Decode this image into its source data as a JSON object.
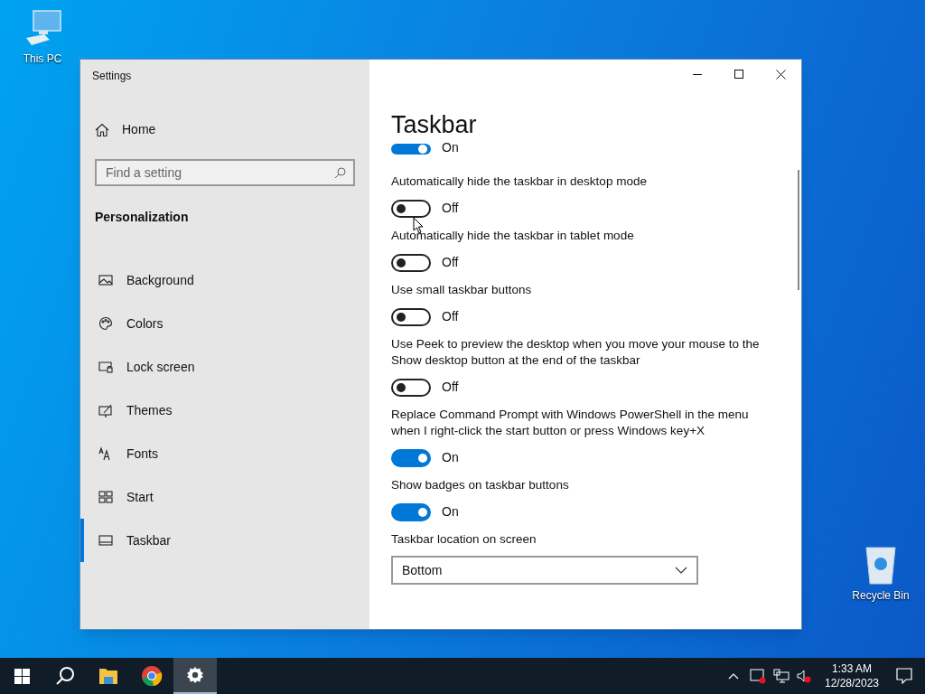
{
  "desktop": {
    "icons": [
      {
        "kind": "pc",
        "label": "This PC"
      },
      {
        "kind": "bin",
        "label": "Recycle Bin"
      }
    ]
  },
  "window": {
    "title": "Settings"
  },
  "sidebar": {
    "home": "Home",
    "search": {
      "placeholder": "Find a setting"
    },
    "section": "Personalization",
    "items": [
      {
        "kind": "background",
        "label": "Background",
        "selected": false
      },
      {
        "kind": "colors",
        "label": "Colors",
        "selected": false
      },
      {
        "kind": "lock",
        "label": "Lock screen",
        "selected": false
      },
      {
        "kind": "themes",
        "label": "Themes",
        "selected": false
      },
      {
        "kind": "fonts",
        "label": "Fonts",
        "selected": false
      },
      {
        "kind": "start",
        "label": "Start",
        "selected": false
      },
      {
        "kind": "taskbar",
        "label": "Taskbar",
        "selected": true
      }
    ]
  },
  "page": {
    "title": "Taskbar",
    "settings": [
      {
        "kind": "toggle",
        "on": true,
        "state": "On"
      },
      {
        "kind": "toggle",
        "label": "Automatically hide the taskbar in desktop mode",
        "on": false,
        "state": "Off"
      },
      {
        "kind": "toggle",
        "label": "Automatically hide the taskbar in tablet mode",
        "on": false,
        "state": "Off"
      },
      {
        "kind": "toggle",
        "label": "Use small taskbar buttons",
        "on": false,
        "state": "Off"
      },
      {
        "kind": "toggle",
        "label": "Use Peek to preview the desktop when you move your mouse to the Show desktop button at the end of the taskbar",
        "on": false,
        "state": "Off"
      },
      {
        "kind": "toggle",
        "label": "Replace Command Prompt with Windows PowerShell in the menu when I right-click the start button or press Windows key+X",
        "on": true,
        "state": "On"
      },
      {
        "kind": "toggle",
        "label": "Show badges on taskbar buttons",
        "on": true,
        "state": "On"
      },
      {
        "kind": "dropdown",
        "label": "Taskbar location on screen",
        "value": "Bottom"
      }
    ]
  },
  "taskbar": {
    "apps": [
      {
        "kind": "start",
        "selected": false
      },
      {
        "kind": "search",
        "selected": false
      },
      {
        "kind": "folder",
        "selected": false
      },
      {
        "kind": "chrome",
        "selected": false
      },
      {
        "kind": "settings",
        "selected": true
      }
    ],
    "time": "1:33 AM",
    "date": "12/28/2023"
  }
}
